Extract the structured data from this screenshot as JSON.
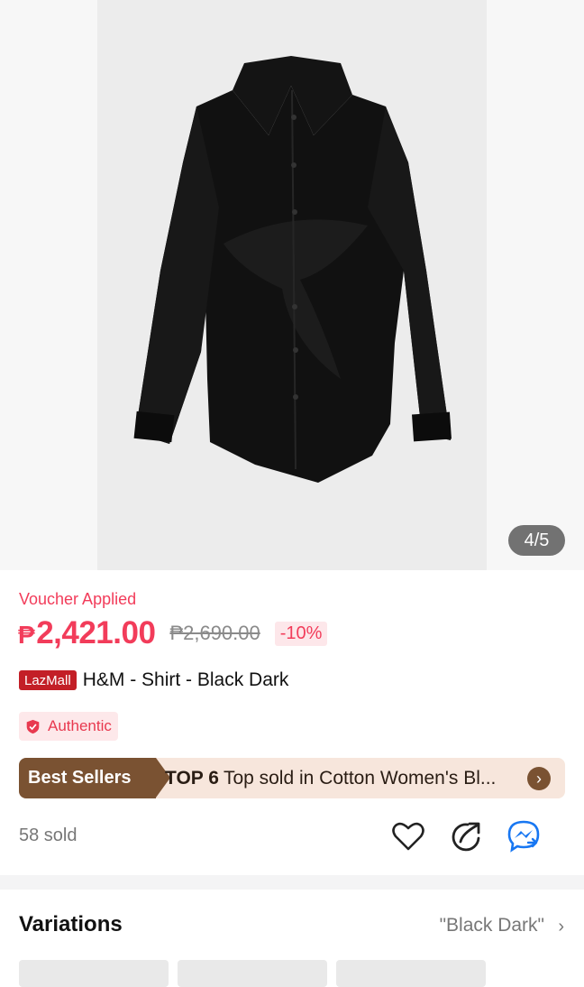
{
  "gallery": {
    "image_alt": "black shirt",
    "counter": "4/5"
  },
  "product": {
    "voucher_label": "Voucher Applied",
    "currency": "₱",
    "price": "2,421.00",
    "original_price": "₱2,690.00",
    "discount": "-10%",
    "mall_badge": "LazMall",
    "title": "H&M - Shirt - Black Dark",
    "authentic_label": "Authentic",
    "sold": "58 sold"
  },
  "best_sellers": {
    "tag": "Best Sellers",
    "rank": "TOP 6",
    "text": "Top sold in Cotton Women's Bl..."
  },
  "actions": {
    "icons": [
      "heart-icon",
      "share-icon",
      "messenger-icon"
    ]
  },
  "variations": {
    "label": "Variations",
    "selected": "\"Black Dark\""
  },
  "colors": {
    "accent": "#f23c5a",
    "lazmall": "#c31f27",
    "bestseller": "#7a5232"
  }
}
